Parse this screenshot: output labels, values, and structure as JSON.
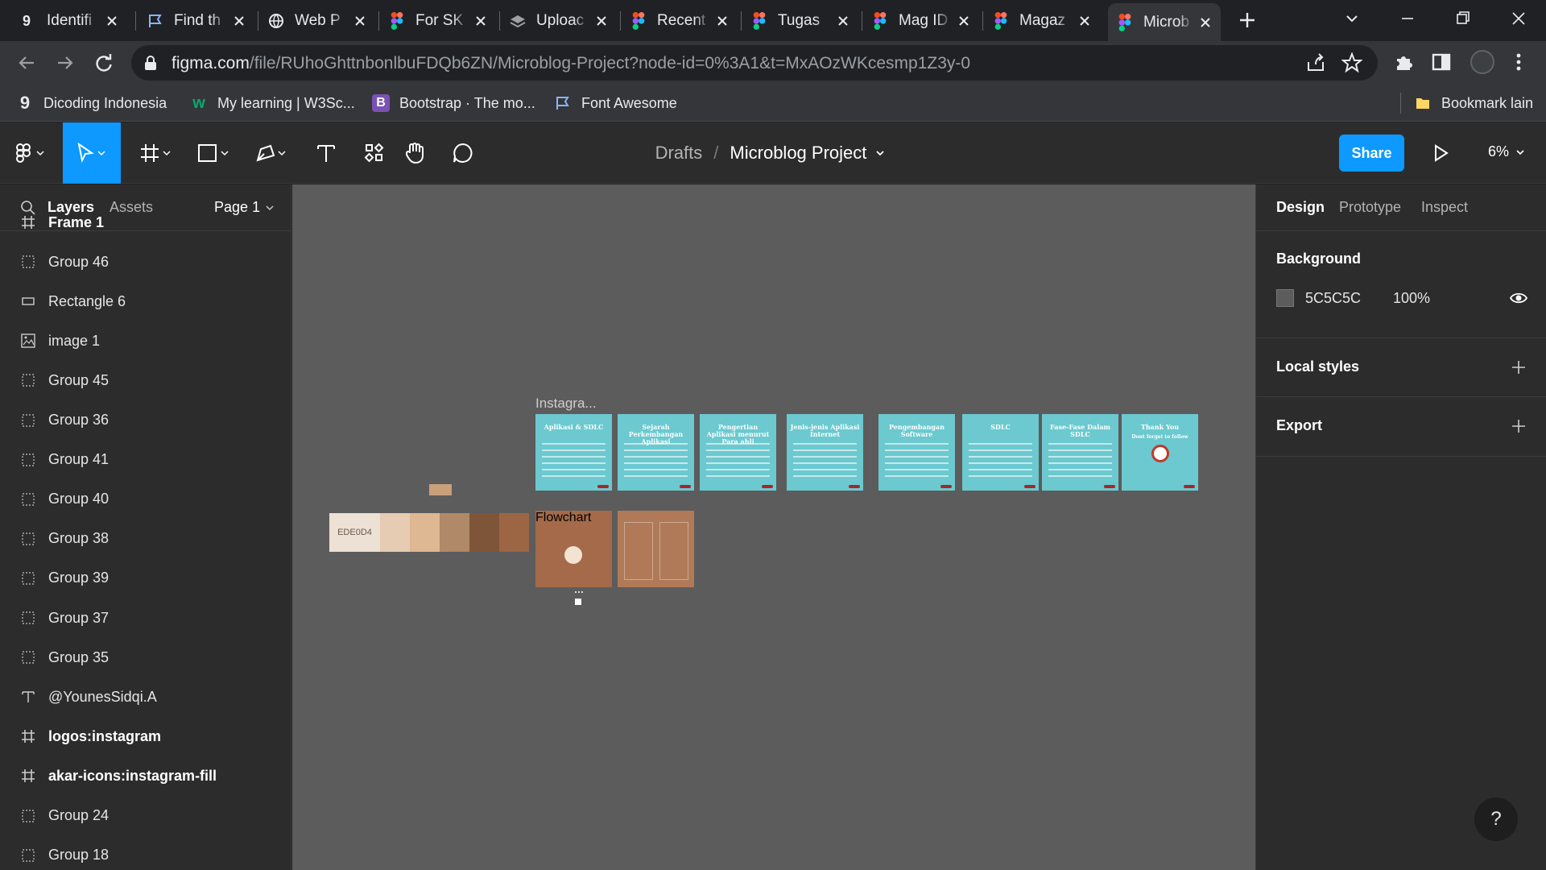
{
  "browser": {
    "tabs": [
      {
        "title": "Identifi",
        "icon": "dicoding-icon"
      },
      {
        "title": "Find th",
        "icon": "flag-icon"
      },
      {
        "title": "Web P",
        "icon": "globe-icon"
      },
      {
        "title": "For SK",
        "icon": "figma-icon"
      },
      {
        "title": "Uploac",
        "icon": "layers-icon"
      },
      {
        "title": "Recent",
        "icon": "figma-icon"
      },
      {
        "title": "Tugas",
        "icon": "figma-icon"
      },
      {
        "title": "Mag ID",
        "icon": "figma-icon"
      },
      {
        "title": "Magaz",
        "icon": "figma-icon"
      },
      {
        "title": "Microb",
        "icon": "figma-icon",
        "active": true
      }
    ],
    "url_host": "figma.com",
    "url_path": "/file/RUhoGhttnbonlbuFDQb6ZN/Microblog-Project?node-id=0%3A1&t=MxAOzWKcesmp1Z3y-0",
    "bookmarks": [
      {
        "label": "Dicoding Indonesia",
        "icon": "dicoding-icon"
      },
      {
        "label": "My learning | W3Sc...",
        "icon": "w3schools-icon"
      },
      {
        "label": "Bootstrap · The mo...",
        "icon": "bootstrap-icon"
      },
      {
        "label": "Font Awesome",
        "icon": "flag-icon"
      }
    ],
    "other_bookmarks": "Bookmark lain"
  },
  "figma": {
    "breadcrumb": {
      "parent": "Drafts",
      "separator": "/",
      "file": "Microblog Project"
    },
    "share_label": "Share",
    "zoom": "6%",
    "left_tabs": {
      "layers": "Layers",
      "assets": "Assets",
      "page": "Page 1"
    },
    "layers": [
      {
        "name": "Frame 1",
        "type": "frame",
        "bold": true
      },
      {
        "name": "Group 46",
        "type": "group"
      },
      {
        "name": "Rectangle 6",
        "type": "rectangle"
      },
      {
        "name": "image 1",
        "type": "image"
      },
      {
        "name": "Group 45",
        "type": "group"
      },
      {
        "name": "Group 36",
        "type": "group"
      },
      {
        "name": "Group 41",
        "type": "group"
      },
      {
        "name": "Group 40",
        "type": "group"
      },
      {
        "name": "Group 38",
        "type": "group"
      },
      {
        "name": "Group 39",
        "type": "group"
      },
      {
        "name": "Group 37",
        "type": "group"
      },
      {
        "name": "Group 35",
        "type": "group"
      },
      {
        "name": "@YounesSidqi.A",
        "type": "text"
      },
      {
        "name": "logos:instagram",
        "type": "frame",
        "bold": true
      },
      {
        "name": "akar-icons:instagram-fill",
        "type": "frame",
        "bold": true
      },
      {
        "name": "Group 24",
        "type": "group"
      },
      {
        "name": "Group 18",
        "type": "group"
      }
    ],
    "canvas": {
      "frame_label": "Instagra...",
      "palette_label": "EDE0D4",
      "palette_colors": [
        "#ede0d4",
        "#e6ccb2",
        "#ddb892",
        "#b08968",
        "#7f5539",
        "#9c6644"
      ],
      "teal_slides": [
        {
          "title": "Aplikasi & SDLC"
        },
        {
          "title": "Sejarah Perkembangan Aplikasi"
        },
        {
          "title": "Pengertian Aplikasi menurut Para ahli"
        },
        {
          "title": "Jenis-jenis Aplikasi Internet"
        },
        {
          "title": "Pengembangan Software"
        },
        {
          "title": "SDLC"
        },
        {
          "title": "Fase-Fase Dalam SDLC"
        },
        {
          "title": "Thank You",
          "subtitle": "Dont forget to follow"
        }
      ],
      "brown_slides": [
        {
          "title": "Flowchart"
        },
        {
          "title": ""
        }
      ]
    },
    "right_tabs": {
      "design": "Design",
      "prototype": "Prototype",
      "inspect": "Inspect"
    },
    "background": {
      "label": "Background",
      "hex": "5C5C5C",
      "opacity": "100%",
      "color": "#5c5c5c"
    },
    "local_styles": "Local styles",
    "export": "Export",
    "help": "?"
  },
  "colors": {
    "accent": "#0d99ff",
    "teal": "#6bc9cf",
    "brown": "#a46a4a"
  }
}
